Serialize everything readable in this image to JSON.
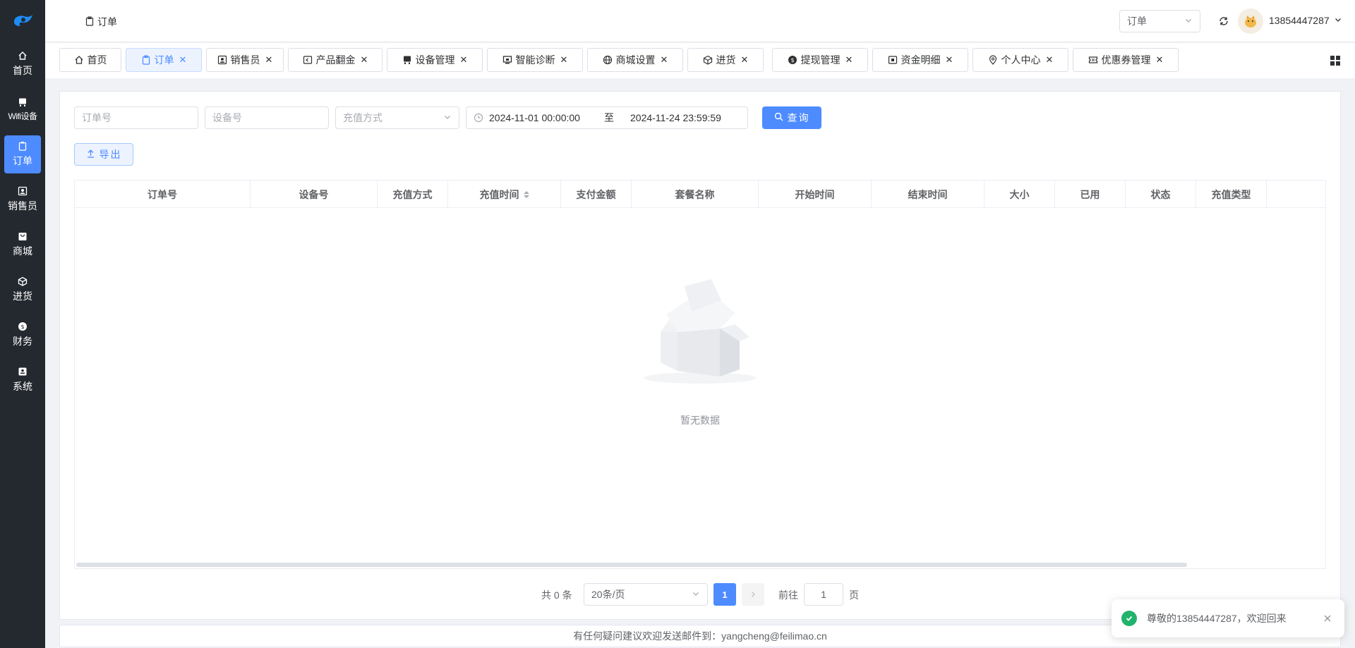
{
  "colors": {
    "sidebar_bg": "#24292f",
    "accent": "#4d8bff",
    "success": "#21b36b"
  },
  "header": {
    "breadcrumb": "订单",
    "module_select": "订单",
    "username": "13854447287"
  },
  "sidebar": {
    "items": [
      {
        "label": "首页",
        "icon": "home-icon"
      },
      {
        "label": "Wifi设备",
        "icon": "device-icon"
      },
      {
        "label": "订单",
        "icon": "clipboard-icon"
      },
      {
        "label": "销售员",
        "icon": "contact-icon"
      },
      {
        "label": "商城",
        "icon": "shop-bag-icon"
      },
      {
        "label": "进货",
        "icon": "box-icon"
      },
      {
        "label": "财务",
        "icon": "coin-icon"
      },
      {
        "label": "系统",
        "icon": "system-icon"
      }
    ]
  },
  "tabs": [
    {
      "label": "首页",
      "icon": "home-icon"
    },
    {
      "label": "订单",
      "icon": "clipboard-icon"
    },
    {
      "label": "销售员",
      "icon": "contact-icon"
    },
    {
      "label": "产品翻金",
      "icon": "wallet-icon"
    },
    {
      "label": "设备管理",
      "icon": "device-icon"
    },
    {
      "label": "智能诊断",
      "icon": "monitor-icon"
    },
    {
      "label": "商城设置",
      "icon": "globe-icon"
    },
    {
      "label": "进货",
      "icon": "box-icon"
    },
    {
      "label": "提现管理",
      "icon": "coin-icon"
    },
    {
      "label": "资金明细",
      "icon": "ledger-icon"
    },
    {
      "label": "个人中心",
      "icon": "location-icon"
    },
    {
      "label": "优惠券管理",
      "icon": "ticket-icon"
    }
  ],
  "filters": {
    "order_no_placeholder": "订单号",
    "device_no_placeholder": "设备号",
    "recharge_method_placeholder": "充值方式",
    "start_date": "2024-11-01 00:00:00",
    "range_separator": "至",
    "end_date": "2024-11-24 23:59:59",
    "query_label": "查询",
    "export_label": "导出"
  },
  "table": {
    "columns": [
      "订单号",
      "设备号",
      "充值方式",
      "充值时间",
      "支付金额",
      "套餐名称",
      "开始时间",
      "结束时间",
      "大小",
      "已用",
      "状态",
      "充值类型"
    ],
    "rows": [],
    "empty_text": "暂无数据"
  },
  "pagination": {
    "total_text": "共 0 条",
    "page_size": "20条/页",
    "current_page": "1",
    "goto_label": "前往",
    "goto_value": "1",
    "page_unit": "页"
  },
  "footer": {
    "text": "有任何疑问建议欢迎发送邮件到：yangcheng@feilimao.cn"
  },
  "toast": {
    "message": "尊敬的13854447287，欢迎回来"
  }
}
